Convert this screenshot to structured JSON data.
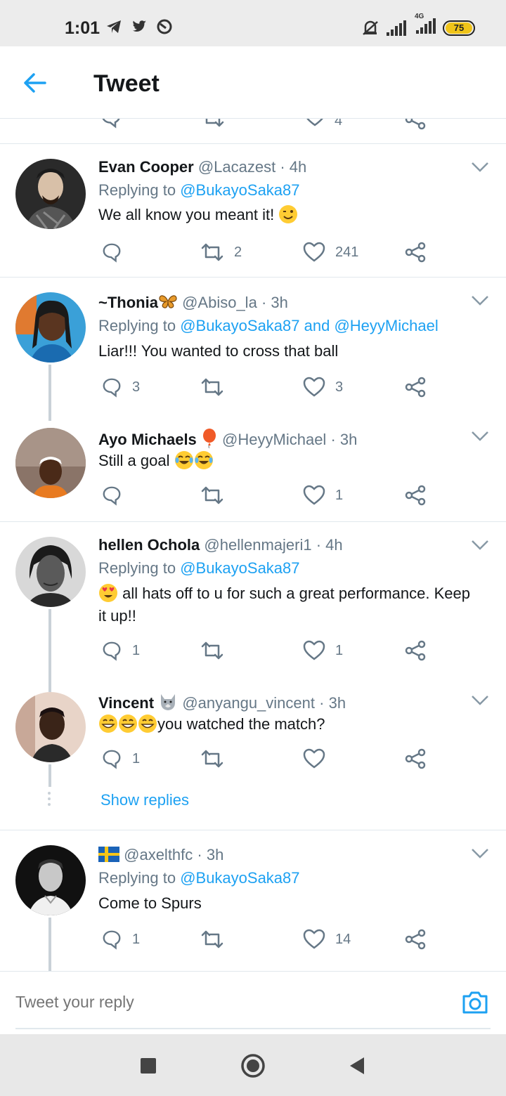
{
  "status_bar": {
    "time": "1:01",
    "battery": "75",
    "network": "4G"
  },
  "header": {
    "title": "Tweet"
  },
  "tweets": [
    {
      "name": "Evan Cooper",
      "handle": "@Lacazest",
      "time": "4h",
      "replying_prefix": "Replying to ",
      "mentions": "@BukayoSaka87",
      "mentions2": "",
      "text": "We all know you meant it! ",
      "replies": "",
      "retweets": "2",
      "likes": "241"
    },
    {
      "name": "~Thonia",
      "handle": "@Abiso_la",
      "time": "3h",
      "replying_prefix": "Replying to ",
      "mentions": "@BukayoSaka87",
      "and": " and ",
      "mentions2": "@HeyyMichael",
      "text": "Liar!!! You wanted to cross that ball",
      "replies": "3",
      "retweets": "",
      "likes": "3"
    },
    {
      "name": "Ayo Michaels",
      "handle": "@HeyyMichael",
      "time": "3h",
      "text": "Still a goal ",
      "replies": "",
      "retweets": "",
      "likes": "1"
    },
    {
      "name": "hellen Ochola",
      "handle": "@hellenmajeri1",
      "time": "4h",
      "replying_prefix": "Replying to ",
      "mentions": "@BukayoSaka87",
      "text": " all hats off to u for such a great performance. Keep it up!!",
      "replies": "1",
      "retweets": "",
      "likes": "1"
    },
    {
      "name": "Vincent",
      "handle": "@anyangu_vincent",
      "time": "3h",
      "text": "you watched the match?",
      "replies": "1",
      "retweets": "",
      "likes": ""
    },
    {
      "name": "",
      "handle": "@axelthfc",
      "time": "3h",
      "replying_prefix": "Replying to ",
      "mentions": "@BukayoSaka87",
      "text": "Come to Spurs",
      "replies": "1",
      "retweets": "",
      "likes": "14"
    }
  ],
  "show_replies_label": "Show replies",
  "reply_bar": {
    "placeholder": "Tweet your reply"
  },
  "prev_tweet_likes": "4",
  "colors": {
    "accent": "#1da1f2",
    "text": "#14171a",
    "secondary": "#657786",
    "divider": "#e1e8ed"
  }
}
